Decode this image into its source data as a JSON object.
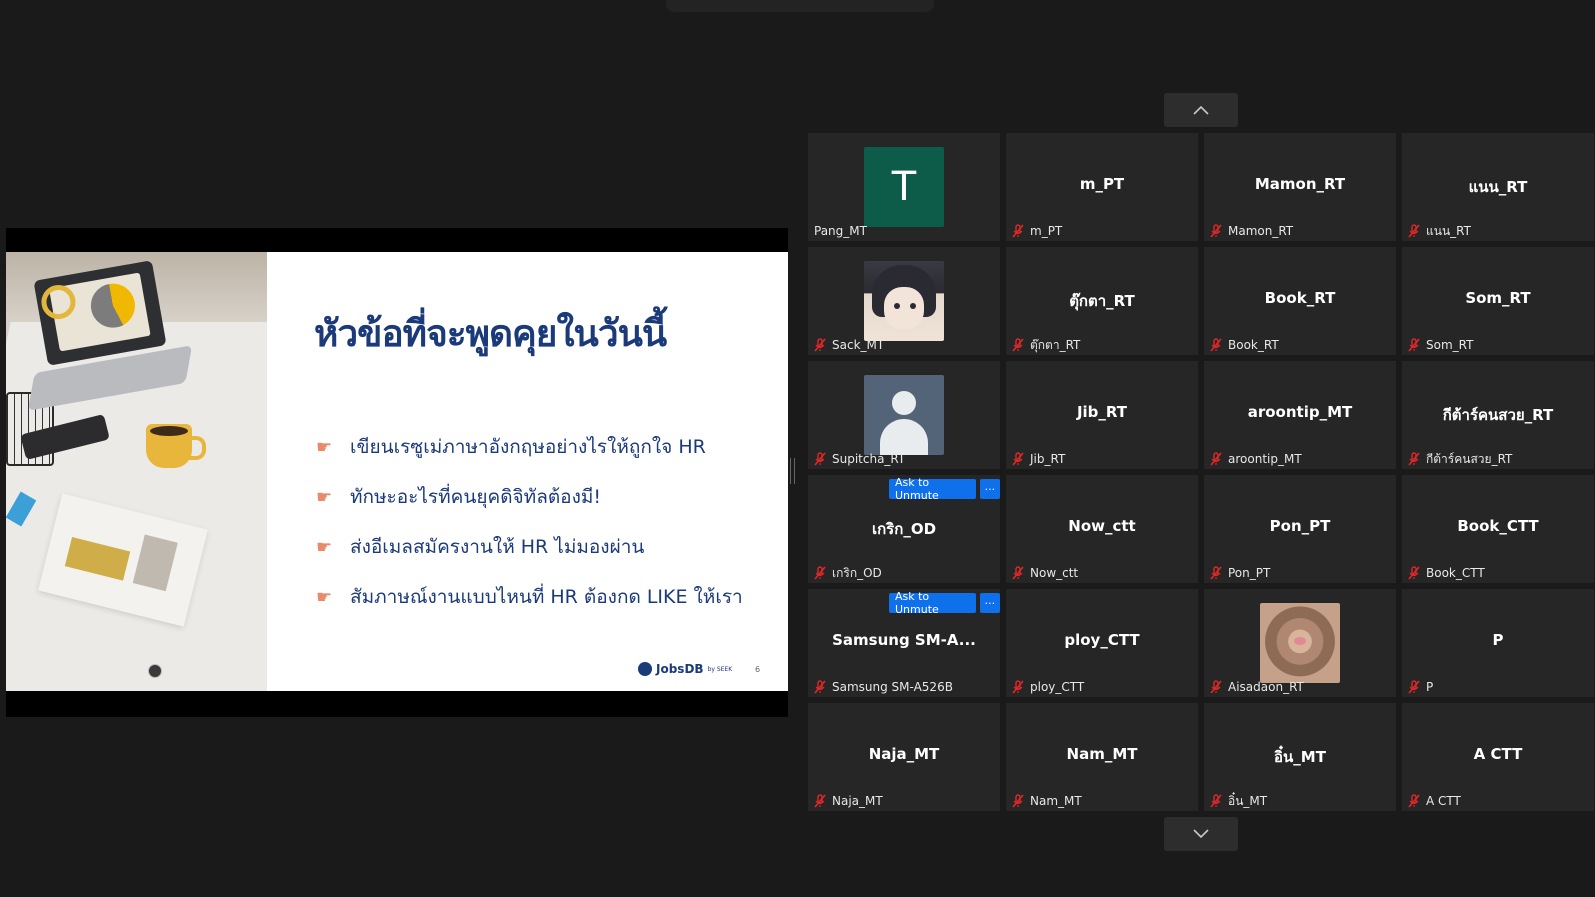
{
  "slide": {
    "title": "หัวข้อที่จะพูดคุยในวันนี้",
    "bullets": [
      "เขียนเรซูเม่ภาษาอังกฤษอย่างไรให้ถูกใจ HR",
      "ทักษะอะไรที่คนยุคดิจิทัลต้องมี!",
      "ส่งอีเมลสมัครงานให้ HR ไม่มองผ่าน",
      "สัมภาษณ์งานแบบไหนที่ HR ต้องกด LIKE ให้เรา"
    ],
    "logo_text": "JobsDB",
    "logo_sub": "by SEEK",
    "page_number": "6"
  },
  "nav": {
    "up_icon": "chevron-up-icon",
    "down_icon": "chevron-down-icon"
  },
  "colors": {
    "background": "#1a1a1a",
    "tile": "#262626",
    "unmute_blue": "#0e71eb",
    "muted_red": "#e02828",
    "slide_navy": "#1b3a7a"
  },
  "participants": [
    {
      "display": "",
      "label": "Pang_MT",
      "muted": false,
      "avatar": "letter",
      "letter": "T"
    },
    {
      "display": "m_PT",
      "label": "m_PT",
      "muted": true
    },
    {
      "display": "Mamon_RT",
      "label": "Mamon_RT",
      "muted": true
    },
    {
      "display": "แนน_RT",
      "label": "แนน_RT",
      "muted": true
    },
    {
      "display": "",
      "label": "Sack_MT",
      "muted": true,
      "avatar": "anime"
    },
    {
      "display": "ตุ๊กตา_RT",
      "label": "ตุ๊กตา_RT",
      "muted": true
    },
    {
      "display": "Book_RT",
      "label": "Book_RT",
      "muted": true
    },
    {
      "display": "Som_RT",
      "label": "Som_RT",
      "muted": true
    },
    {
      "display": "",
      "label": "Supitcha_RT",
      "muted": true,
      "avatar": "default"
    },
    {
      "display": "Jib_RT",
      "label": "Jib_RT",
      "muted": true
    },
    {
      "display": "aroontip_MT",
      "label": "aroontip_MT",
      "muted": true
    },
    {
      "display": "กีต้าร์คนสวย_RT",
      "label": "กีต้าร์คนสวย_RT",
      "muted": true
    },
    {
      "display": "เกริก_OD",
      "label": "เกริก_OD",
      "muted": true,
      "ask_to_unmute": "Ask to Unmute",
      "more": "···"
    },
    {
      "display": "Now_ctt",
      "label": "Now_ctt",
      "muted": true
    },
    {
      "display": "Pon_PT",
      "label": "Pon_PT",
      "muted": true
    },
    {
      "display": "Book_CTT",
      "label": "Book_CTT",
      "muted": true
    },
    {
      "display": "Samsung  SM-A...",
      "label": "Samsung SM-A526B",
      "muted": true,
      "ask_to_unmute": "Ask to Unmute",
      "more": "···"
    },
    {
      "display": "ploy_CTT",
      "label": "ploy_CTT",
      "muted": true
    },
    {
      "display": "",
      "label": "Aisadaon_RT",
      "muted": true,
      "avatar": "cat"
    },
    {
      "display": "P",
      "label": "P",
      "muted": true
    },
    {
      "display": "Naja_MT",
      "label": "Naja_MT",
      "muted": true
    },
    {
      "display": "Nam_MT",
      "label": "Nam_MT",
      "muted": true
    },
    {
      "display": "อิ๋น_MT",
      "label": "อิ๋น_MT",
      "muted": true
    },
    {
      "display": "A CTT",
      "label": "A CTT",
      "muted": true
    }
  ]
}
